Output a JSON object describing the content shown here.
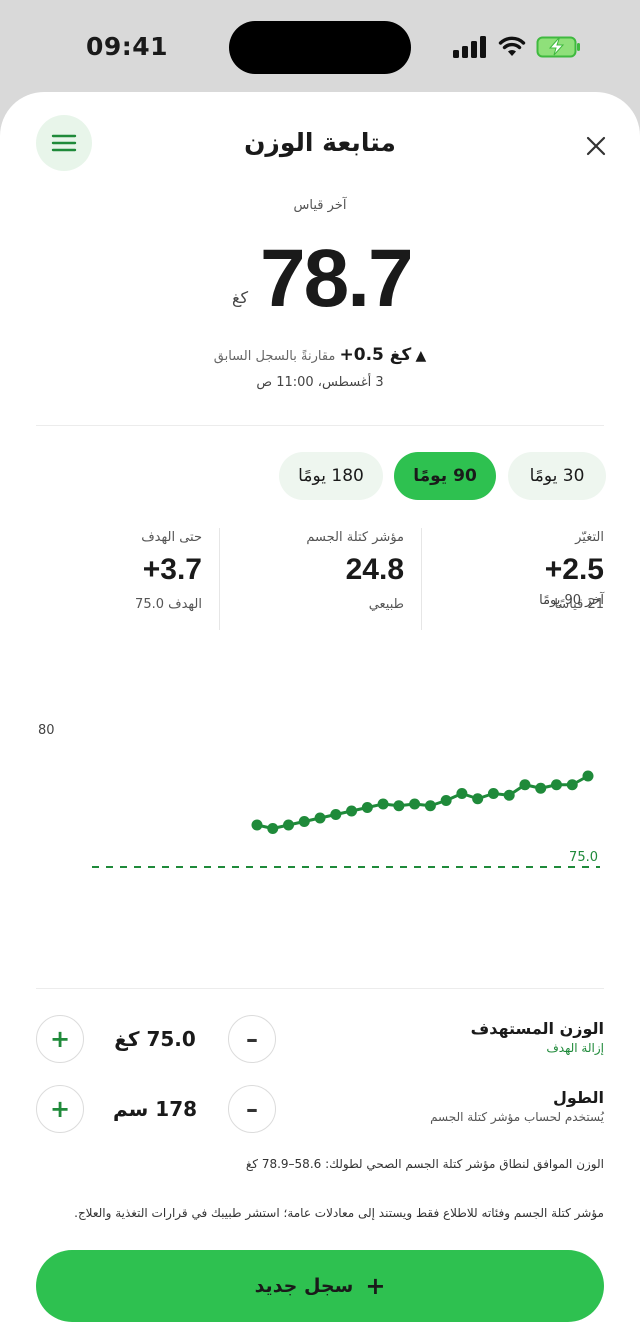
{
  "status": {
    "time": "09:41"
  },
  "header": {
    "title": "متابعة الوزن"
  },
  "latest": {
    "label": "آخر قياس",
    "value": "78.7",
    "unit": "كغ",
    "delta": "+0.5 كغ",
    "delta_text": "مقارنةً بالسجل السابق",
    "date": "3 أغسطس، 11:00 ص"
  },
  "range_tabs": [
    {
      "label": "30 يومًا",
      "active": false
    },
    {
      "label": "90 يومًا",
      "active": true
    },
    {
      "label": "180 يومًا",
      "active": false
    }
  ],
  "stats": [
    {
      "label": "التغيّر",
      "value": "+2.5",
      "sub": "21 قياسًا"
    },
    {
      "label": "مؤشر كتلة الجسم",
      "value": "24.8",
      "sub": "طبيعي"
    },
    {
      "label": "حتى الهدف",
      "value": "+3.7",
      "sub": "الهدف 75.0"
    }
  ],
  "chart_data": {
    "type": "line",
    "title": "آخر 90 يومًا",
    "ylim": [
      74,
      80
    ],
    "y_ticks": [
      "80",
      "74"
    ],
    "series": [
      {
        "values": [
          76.2,
          76.1,
          76.2,
          76.3,
          76.4,
          76.5,
          76.6,
          76.7,
          76.8,
          76.75,
          76.8,
          76.75,
          76.9,
          77.1,
          76.95,
          77.1,
          77.05,
          77.35,
          77.25,
          77.35,
          77.35,
          77.6
        ]
      }
    ],
    "goal_line": {
      "value": 75.0,
      "label": "75.0"
    },
    "colors": {
      "line": "#1f8a3a",
      "goal": "#1f8a3a"
    }
  },
  "target": {
    "label": "الوزن المستهدف",
    "sub": "إزالة الهدف",
    "value": "75.0 كغ"
  },
  "height": {
    "label": "الطول",
    "sub": "يُستخدم لحساب مؤشر كتلة الجسم",
    "value": "178 سم"
  },
  "healthy_range": "الوزن الموافق لنطاق مؤشر كتلة الجسم الصحي لطولك: 58.6–78.9 كغ",
  "disclaimer": "مؤشر كتلة الجسم وفئاته للاطلاع فقط ويستند إلى معادلات عامة؛ استشر طبيبك في قرارات التغذية والعلاج.",
  "cta": {
    "label": "سجل جديد",
    "icon": "plus-icon"
  },
  "colors": {
    "accent": "#2ec150",
    "accent_dark": "#1f8a3a",
    "accent_soft": "#eef6ef"
  }
}
